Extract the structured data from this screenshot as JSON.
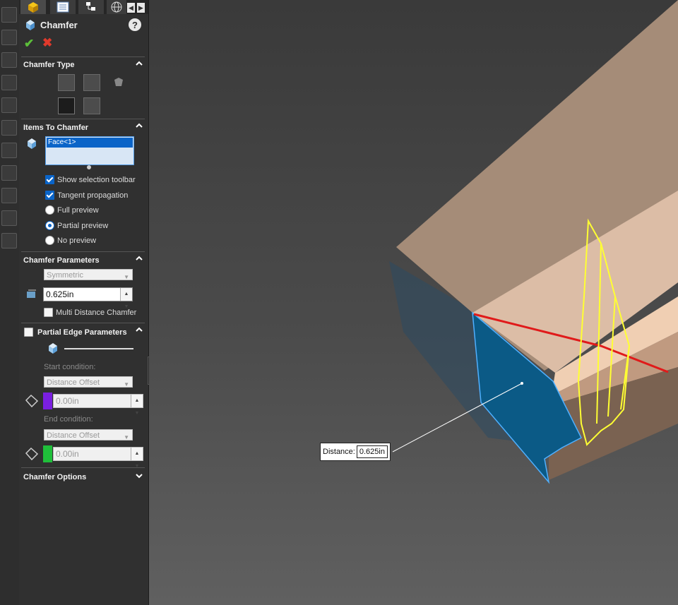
{
  "tabs": [
    {
      "name": "feature-manager-tab",
      "icon": "part-icon"
    },
    {
      "name": "property-manager-tab",
      "icon": "list-icon"
    },
    {
      "name": "configuration-manager-tab",
      "icon": "tree-icon"
    },
    {
      "name": "display-manager-tab",
      "icon": "globe-icon"
    }
  ],
  "panel": {
    "title": "Chamfer",
    "help": "?",
    "chamfer_type": {
      "title": "Chamfer Type"
    },
    "items": {
      "title": "Items To Chamfer",
      "selection": [
        "Face<1>"
      ],
      "show_toolbar": "Show selection toolbar",
      "tangent": "Tangent propagation",
      "full_preview": "Full preview",
      "partial_preview": "Partial preview",
      "no_preview": "No preview",
      "preview_selected": "Partial preview"
    },
    "params": {
      "title": "Chamfer Parameters",
      "mode": "Symmetric",
      "distance": "0.625in",
      "multi": "Multi Distance Chamfer"
    },
    "partial": {
      "title": "Partial Edge Parameters",
      "start_label": "Start condition:",
      "start_condition": "Distance Offset",
      "start_value": "0.00in",
      "end_label": "End condition:",
      "end_condition": "Distance Offset",
      "end_value": "0.00in",
      "start_color": "#7a1fe0",
      "end_color": "#1fbf3a"
    },
    "options": {
      "title": "Chamfer Options"
    }
  },
  "callout": {
    "label": "Distance:",
    "value": "0.625in"
  },
  "colors": {
    "panel_bg": "#303030",
    "selection": "#0a64c8",
    "chamfer_face": "#0b5a86",
    "edge_red": "#e01a1a",
    "preview_yellow": "#ffff33",
    "part_top": "#d9b8a0"
  }
}
